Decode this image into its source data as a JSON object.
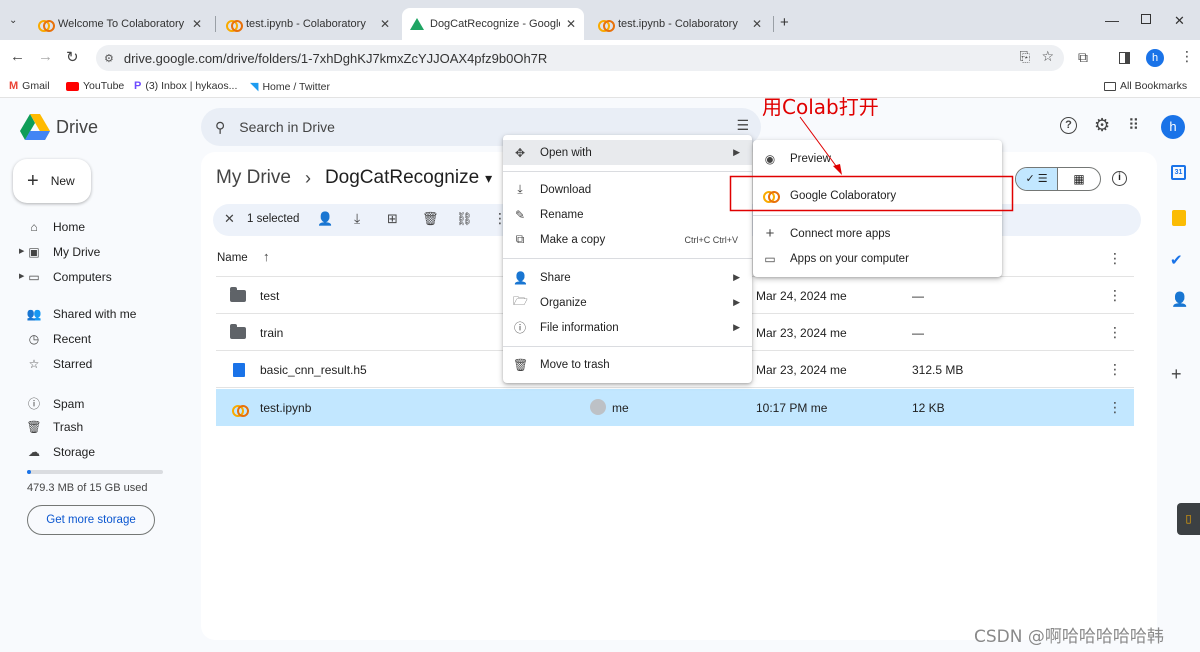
{
  "browser": {
    "tabs": [
      {
        "title": "Welcome To Colaboratory - C",
        "icon": "colab-icon"
      },
      {
        "title": "test.ipynb - Colaboratory",
        "icon": "colab-icon"
      },
      {
        "title": "DogCatRecognize - Google D",
        "icon": "drive-icon"
      },
      {
        "title": "test.ipynb - Colaboratory",
        "icon": "colab-icon"
      }
    ],
    "new_tab": "+",
    "url": "drive.google.com/drive/folders/1-7xhDghKJ7kmxZcYJJOAX4pfz9b0Oh7R",
    "profile_initial": "h",
    "bookmarks": [
      {
        "label": "Gmail"
      },
      {
        "label": "YouTube"
      },
      {
        "label": "(3) Inbox | hykaos..."
      },
      {
        "label": "Home / Twitter"
      }
    ],
    "all_bookmarks": "All Bookmarks"
  },
  "drive": {
    "logo_text": "Drive",
    "search_placeholder": "Search in Drive",
    "new_button": "New",
    "profile_initial": "h",
    "sidebar": [
      {
        "label": "Home"
      },
      {
        "label": "My Drive"
      },
      {
        "label": "Computers"
      },
      {
        "label": "Shared with me"
      },
      {
        "label": "Recent"
      },
      {
        "label": "Starred"
      },
      {
        "label": "Spam"
      },
      {
        "label": "Trash"
      },
      {
        "label": "Storage"
      }
    ],
    "storage_text": "479.3 MB of 15 GB used",
    "storage_used_fraction": 0.03,
    "get_storage_button": "Get more storage",
    "breadcrumb": {
      "root": "My Drive",
      "separator": "›",
      "current": "DogCatRecognize",
      "dropdown": "▾"
    },
    "selection": {
      "count_label": "1 selected"
    },
    "columns": {
      "name": "Name"
    },
    "files": [
      {
        "name": "test",
        "owner": "",
        "modified": "Mar 24, 2024 me",
        "size": "—",
        "type": "folder"
      },
      {
        "name": "train",
        "owner": "",
        "modified": "Mar 23, 2024 me",
        "size": "—",
        "type": "folder"
      },
      {
        "name": "basic_cnn_result.h5",
        "owner": "",
        "modified": "Mar 23, 2024 me",
        "size": "312.5 MB",
        "type": "file"
      },
      {
        "name": "test.ipynb",
        "owner": "me",
        "modified": "10:17 PM me",
        "size": "12 KB",
        "type": "colab"
      }
    ]
  },
  "context_menu": {
    "items": [
      {
        "label": "Open with",
        "icon": "move-icon",
        "submenu": true
      },
      {
        "label": "Download",
        "icon": "download-icon"
      },
      {
        "label": "Rename",
        "icon": "pencil-icon"
      },
      {
        "label": "Make a copy",
        "icon": "copy-icon",
        "shortcut": "Ctrl+C Ctrl+V"
      },
      {
        "label": "Share",
        "icon": "share-icon",
        "submenu": true
      },
      {
        "label": "Organize",
        "icon": "folder-open-icon",
        "submenu": true
      },
      {
        "label": "File information",
        "icon": "info-icon",
        "submenu": true
      },
      {
        "label": "Move to trash",
        "icon": "trash-icon"
      }
    ]
  },
  "submenu": {
    "items": [
      {
        "label": "Preview",
        "icon": "eye-icon"
      },
      {
        "label": "Google Colaboratory",
        "icon": "colab-icon"
      },
      {
        "label": "Connect more apps",
        "icon": "plus-icon"
      },
      {
        "label": "Apps on your computer",
        "icon": "laptop-icon"
      }
    ]
  },
  "annotation": {
    "text": "用Colab打开",
    "color": "#e00000"
  },
  "watermark": "CSDN @啊哈哈哈哈哈韩"
}
